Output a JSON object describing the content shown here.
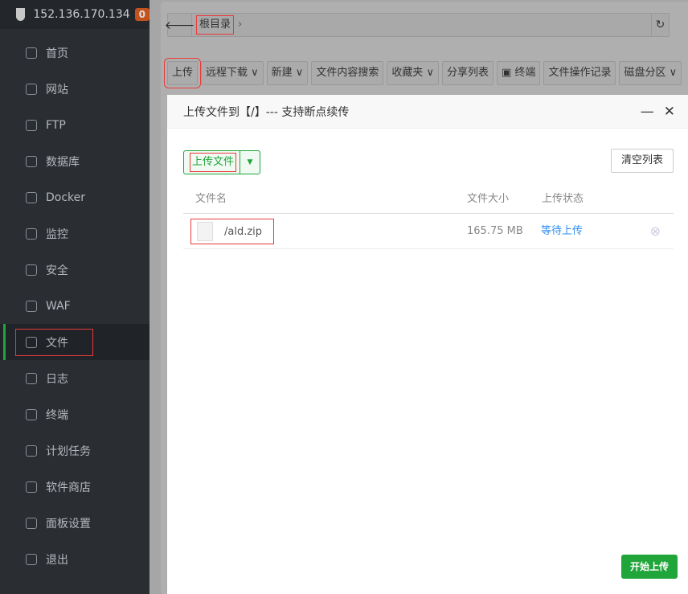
{
  "sidebar": {
    "host": "152.136.170.134",
    "badge": "0",
    "items": [
      {
        "label": "首页",
        "icon": "home-icon"
      },
      {
        "label": "网站",
        "icon": "globe-icon"
      },
      {
        "label": "FTP",
        "icon": "ftp-icon"
      },
      {
        "label": "数据库",
        "icon": "database-icon"
      },
      {
        "label": "Docker",
        "icon": "docker-icon"
      },
      {
        "label": "监控",
        "icon": "monitor-icon"
      },
      {
        "label": "安全",
        "icon": "shield-icon"
      },
      {
        "label": "WAF",
        "icon": "waf-icon"
      },
      {
        "label": "文件",
        "icon": "folder-icon",
        "active": true
      },
      {
        "label": "日志",
        "icon": "log-icon"
      },
      {
        "label": "终端",
        "icon": "terminal-icon"
      },
      {
        "label": "计划任务",
        "icon": "calendar-icon"
      },
      {
        "label": "软件商店",
        "icon": "grid-icon"
      },
      {
        "label": "面板设置",
        "icon": "gear-icon"
      },
      {
        "label": "退出",
        "icon": "logout-icon"
      }
    ]
  },
  "path": {
    "crumb": "根目录"
  },
  "toolbar": [
    "上传",
    "远程下载 ∨",
    "新建 ∨",
    "文件内容搜索",
    "收藏夹 ∨",
    "分享列表",
    "▣ 终端",
    "文件操作记录",
    "磁盘分区 ∨"
  ],
  "modal": {
    "title": "上传文件到【/】--- 支持断点续传",
    "upload_label": "上传文件",
    "clear_label": "清空列表",
    "columns": [
      "文件名",
      "文件大小",
      "上传状态"
    ],
    "files": [
      {
        "name": "/ald.zip",
        "size": "165.75 MB",
        "status": "等待上传"
      }
    ],
    "start_label": "开始上传"
  },
  "colors": {
    "accent": "#20a53a",
    "status": "#2d8cf0",
    "badge": "#c3521c"
  }
}
